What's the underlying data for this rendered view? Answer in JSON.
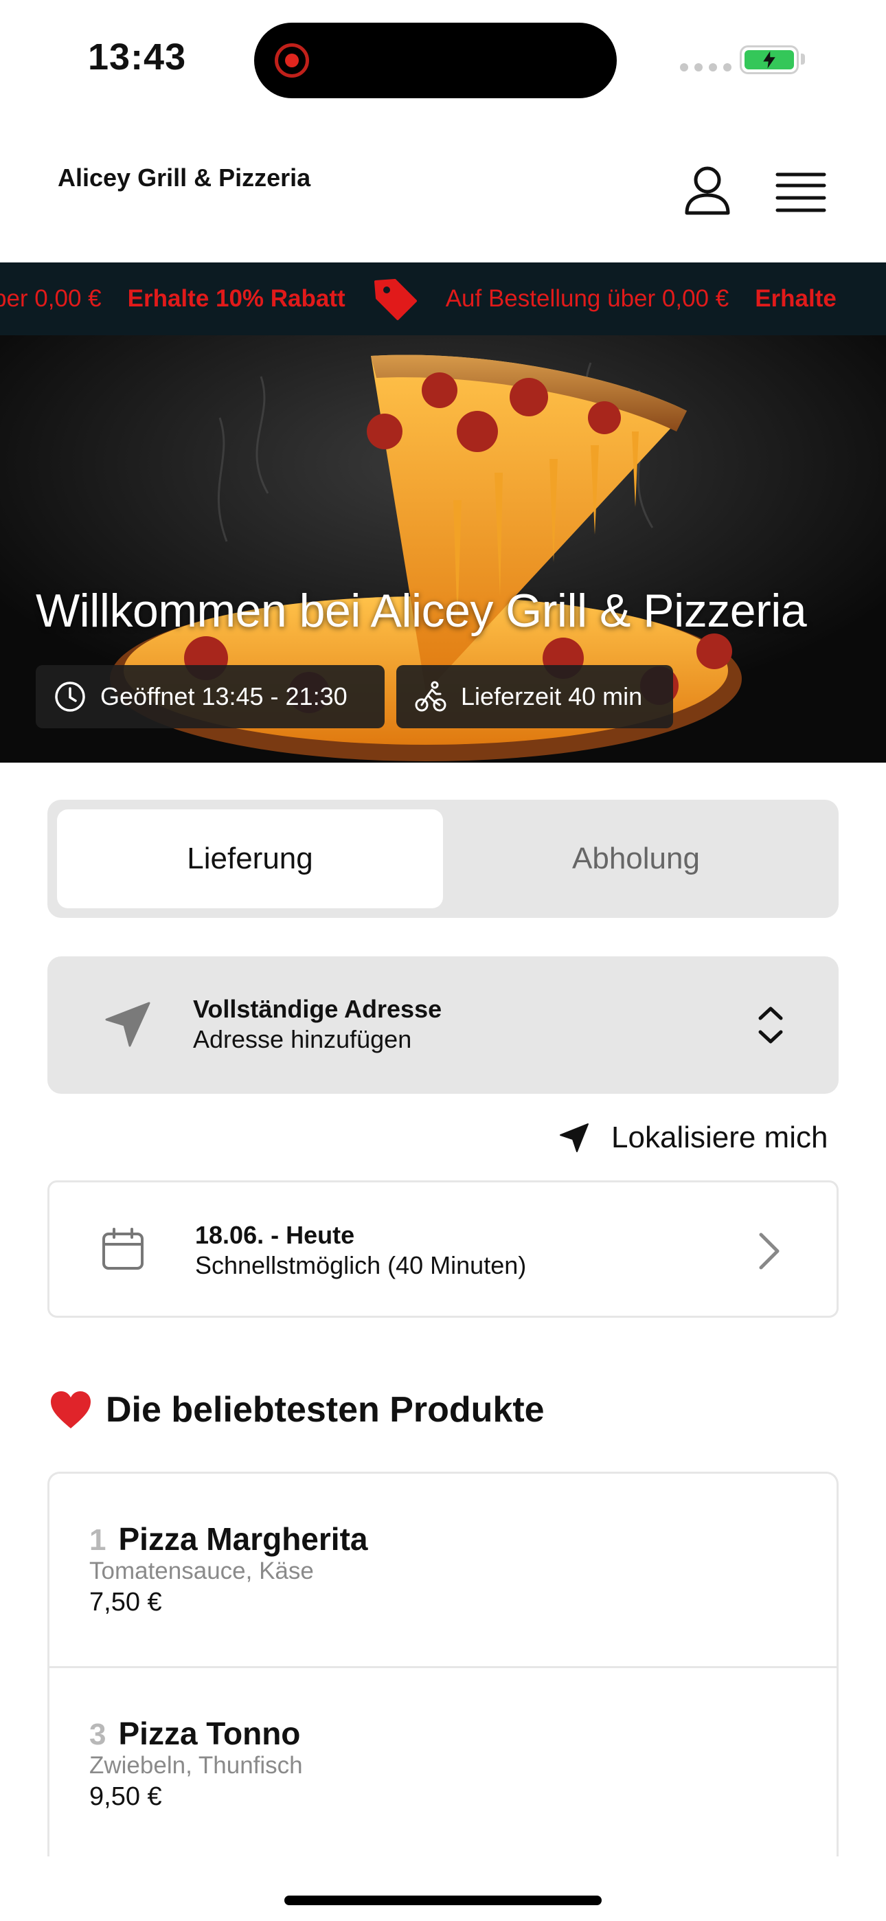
{
  "status_bar": {
    "time": "13:43"
  },
  "header": {
    "brand": "Alicey Grill & Pizzeria"
  },
  "ticker": {
    "items": [
      {
        "text": "ber 0,00 €",
        "bold": false
      },
      {
        "text": "Erhalte 10% Rabatt",
        "bold": true
      },
      {
        "text": "tag",
        "bold": false,
        "icon": "price-tag-icon"
      },
      {
        "text": "Auf Bestellung über 0,00 €",
        "bold": false
      },
      {
        "text": "Erhalte",
        "bold": true
      }
    ],
    "segment_1": "ber 0,00 €",
    "segment_2": "Erhalte 10% Rabatt",
    "segment_3": "Auf Bestellung über 0,00 €",
    "segment_4": "Erhalte",
    "color": "#e11a1a",
    "background": "#0c1b22"
  },
  "hero": {
    "title": "Willkommen bei Alicey Grill & Pizzeria",
    "opening_hours": "Geöffnet 13:45 - 21:30",
    "delivery_time": "Lieferzeit 40 min"
  },
  "mode": {
    "delivery_label": "Lieferung",
    "pickup_label": "Abholung",
    "selected": "Lieferung"
  },
  "address": {
    "title": "Vollständige Adresse",
    "subtitle": "Adresse hinzufügen",
    "locate_label": "Lokalisiere mich"
  },
  "schedule": {
    "date": "18.06. - Heute",
    "time": "Schnellstmöglich (40 Minuten)"
  },
  "popular": {
    "title": "Die beliebtesten Produkte",
    "products": [
      {
        "number": "1",
        "name": "Pizza Margherita",
        "description": "Tomatensauce, Käse",
        "price": "7,50 €"
      },
      {
        "number": "3",
        "name": "Pizza Tonno",
        "description": "Zwiebeln, Thunfisch",
        "price": "9,50 €"
      }
    ]
  }
}
